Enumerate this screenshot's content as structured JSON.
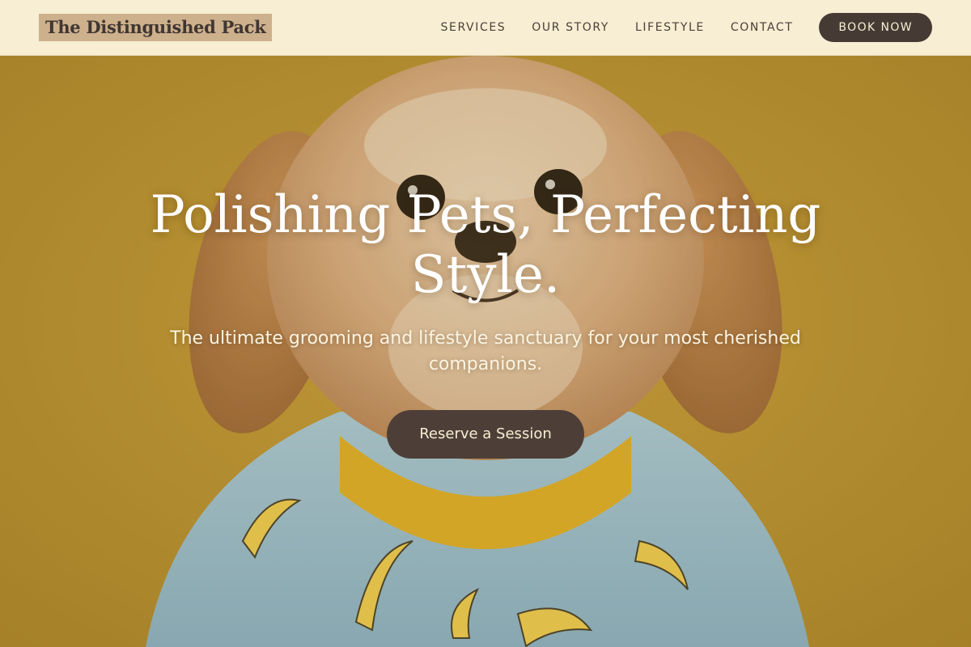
{
  "header": {
    "brand": "The Distinguished Pack",
    "nav": [
      {
        "label": "SERVICES"
      },
      {
        "label": "OUR STORY"
      },
      {
        "label": "LIFESTYLE"
      },
      {
        "label": "CONTACT"
      }
    ],
    "book_label": "BOOK NOW"
  },
  "hero": {
    "title": "Polishing Pets, Perfecting Style.",
    "subtitle": "The ultimate grooming and lifestyle sanctuary for your most cherished companions.",
    "cta_label": "Reserve a Session",
    "image_subject": "shih-tzu-puppy-in-banana-print-shirt"
  },
  "colors": {
    "header_bg": "#f7eed3",
    "logo_bg": "#cdb08c",
    "brand_dark": "#463a34",
    "hero_backdrop": "#c49a38",
    "shirt_blue": "#9cc6e0"
  }
}
